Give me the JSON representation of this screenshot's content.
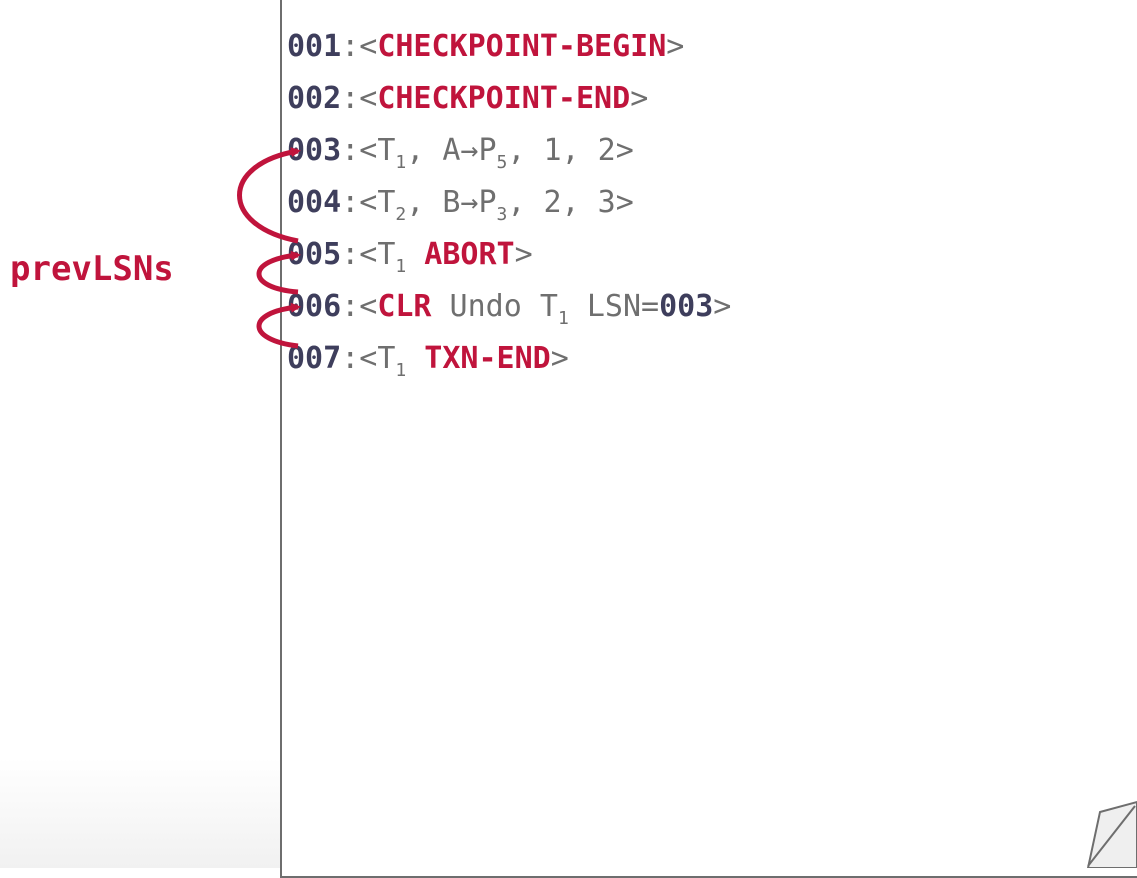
{
  "label": "prevLSNs",
  "colors": {
    "accent": "#c0143c",
    "lsn": "#3e3e5c",
    "text": "#6f6f6f",
    "border": "#6e6e6e"
  },
  "log": [
    {
      "lsn": "001",
      "sep": ":",
      "open": "<",
      "a": "",
      "sub1": "",
      "b": "",
      "kw": "CHECKPOINT-BEGIN",
      "c": "",
      "sub2": "",
      "d": "",
      "ref": "",
      "close": ">"
    },
    {
      "lsn": "002",
      "sep": ":",
      "open": "<",
      "a": "",
      "sub1": "",
      "b": "",
      "kw": "CHECKPOINT-END",
      "c": "",
      "sub2": "",
      "d": "",
      "ref": "",
      "close": ">"
    },
    {
      "lsn": "003",
      "sep": ":",
      "open": "<",
      "a": "T",
      "sub1": "1",
      "b": ", A→P",
      "kw": "",
      "c": "",
      "sub2": "5",
      "d": ", 1, 2",
      "ref": "",
      "close": ">"
    },
    {
      "lsn": "004",
      "sep": ":",
      "open": "<",
      "a": "T",
      "sub1": "2",
      "b": ", B→P",
      "kw": "",
      "c": "",
      "sub2": "3",
      "d": ", 2, 3",
      "ref": "",
      "close": ">"
    },
    {
      "lsn": "005",
      "sep": ":",
      "open": "<",
      "a": "T",
      "sub1": "1",
      "b": " ",
      "kw": "ABORT",
      "c": "",
      "sub2": "",
      "d": "",
      "ref": "",
      "close": ">"
    },
    {
      "lsn": "006",
      "sep": ":",
      "open": "<",
      "a": "",
      "sub1": "",
      "b": "",
      "kw": "CLR",
      "c": " Undo T",
      "sub2": "1",
      "d": " LSN=",
      "ref": "003",
      "close": ">"
    },
    {
      "lsn": "007",
      "sep": ":",
      "open": "<",
      "a": "T",
      "sub1": "1",
      "b": " ",
      "kw": "TXN-END",
      "c": "",
      "sub2": "",
      "d": "",
      "ref": "",
      "close": ">"
    }
  ]
}
